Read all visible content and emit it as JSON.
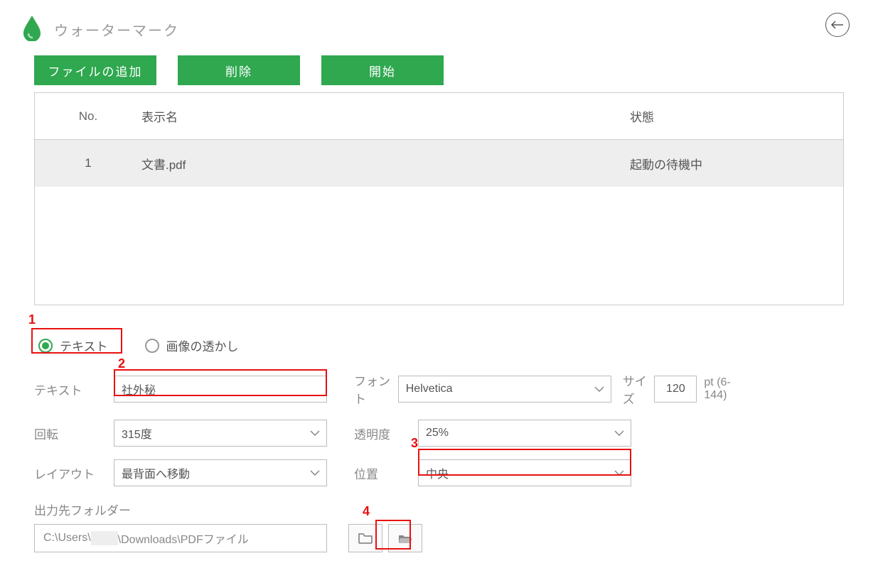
{
  "header": {
    "title": "ウォーターマーク"
  },
  "toolbar": {
    "add": "ファイルの追加",
    "delete": "削除",
    "start": "開始"
  },
  "table": {
    "headers": {
      "no": "No.",
      "name": "表示名",
      "status": "状態"
    },
    "row": {
      "no": "1",
      "name": "文書.pdf",
      "status": "起動の待機中"
    }
  },
  "radio": {
    "text": "テキスト",
    "image": "画像の透かし"
  },
  "fields": {
    "text_label": "テキスト",
    "text_value": "社外秘",
    "font_label": "フォント",
    "font_value": "Helvetica",
    "size_label": "サイズ",
    "size_value": "120",
    "size_suffix": "pt (6-144)",
    "rotation_label": "回転",
    "rotation_value": "315度",
    "opacity_label": "透明度",
    "opacity_value": "25%",
    "layout_label": "レイアウト",
    "layout_value": "最背面へ移動",
    "position_label": "位置",
    "position_value": "中央"
  },
  "output": {
    "label": "出力先フォルダー",
    "path_prefix": "C:\\Users\\",
    "path_obscured": "      ",
    "path_suffix": "\\Downloads\\PDFファイル"
  },
  "annotations": {
    "n1": "1",
    "n2": "2",
    "n3": "3",
    "n4": "4"
  }
}
